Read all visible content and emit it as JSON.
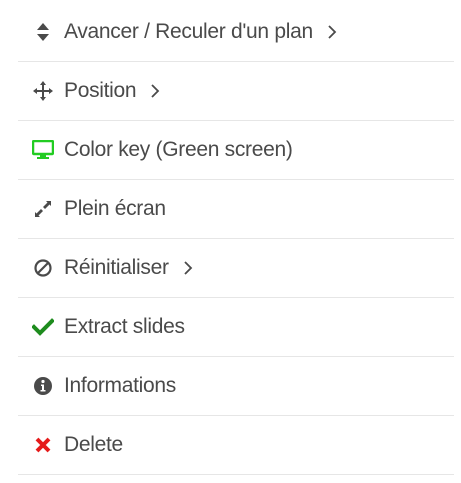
{
  "menu": {
    "items": [
      {
        "label": "Avancer / Reculer d'un plan",
        "icon": "sort-icon",
        "has_submenu": true
      },
      {
        "label": "Position",
        "icon": "move-icon",
        "has_submenu": true
      },
      {
        "label": "Color key (Green screen)",
        "icon": "monitor-icon",
        "has_submenu": false
      },
      {
        "label": "Plein écran",
        "icon": "expand-icon",
        "has_submenu": false
      },
      {
        "label": "Réinitialiser",
        "icon": "ban-icon",
        "has_submenu": true
      },
      {
        "label": "Extract slides",
        "icon": "check-icon",
        "has_submenu": false
      },
      {
        "label": "Informations",
        "icon": "info-icon",
        "has_submenu": false
      },
      {
        "label": "Delete",
        "icon": "close-icon",
        "has_submenu": false
      }
    ]
  },
  "colors": {
    "text": "#4a4a4a",
    "divider": "#e6e6e6",
    "green_screen_icon": "#22cc22",
    "check_icon": "#1e8c1e",
    "delete_icon": "#e51b1b"
  }
}
